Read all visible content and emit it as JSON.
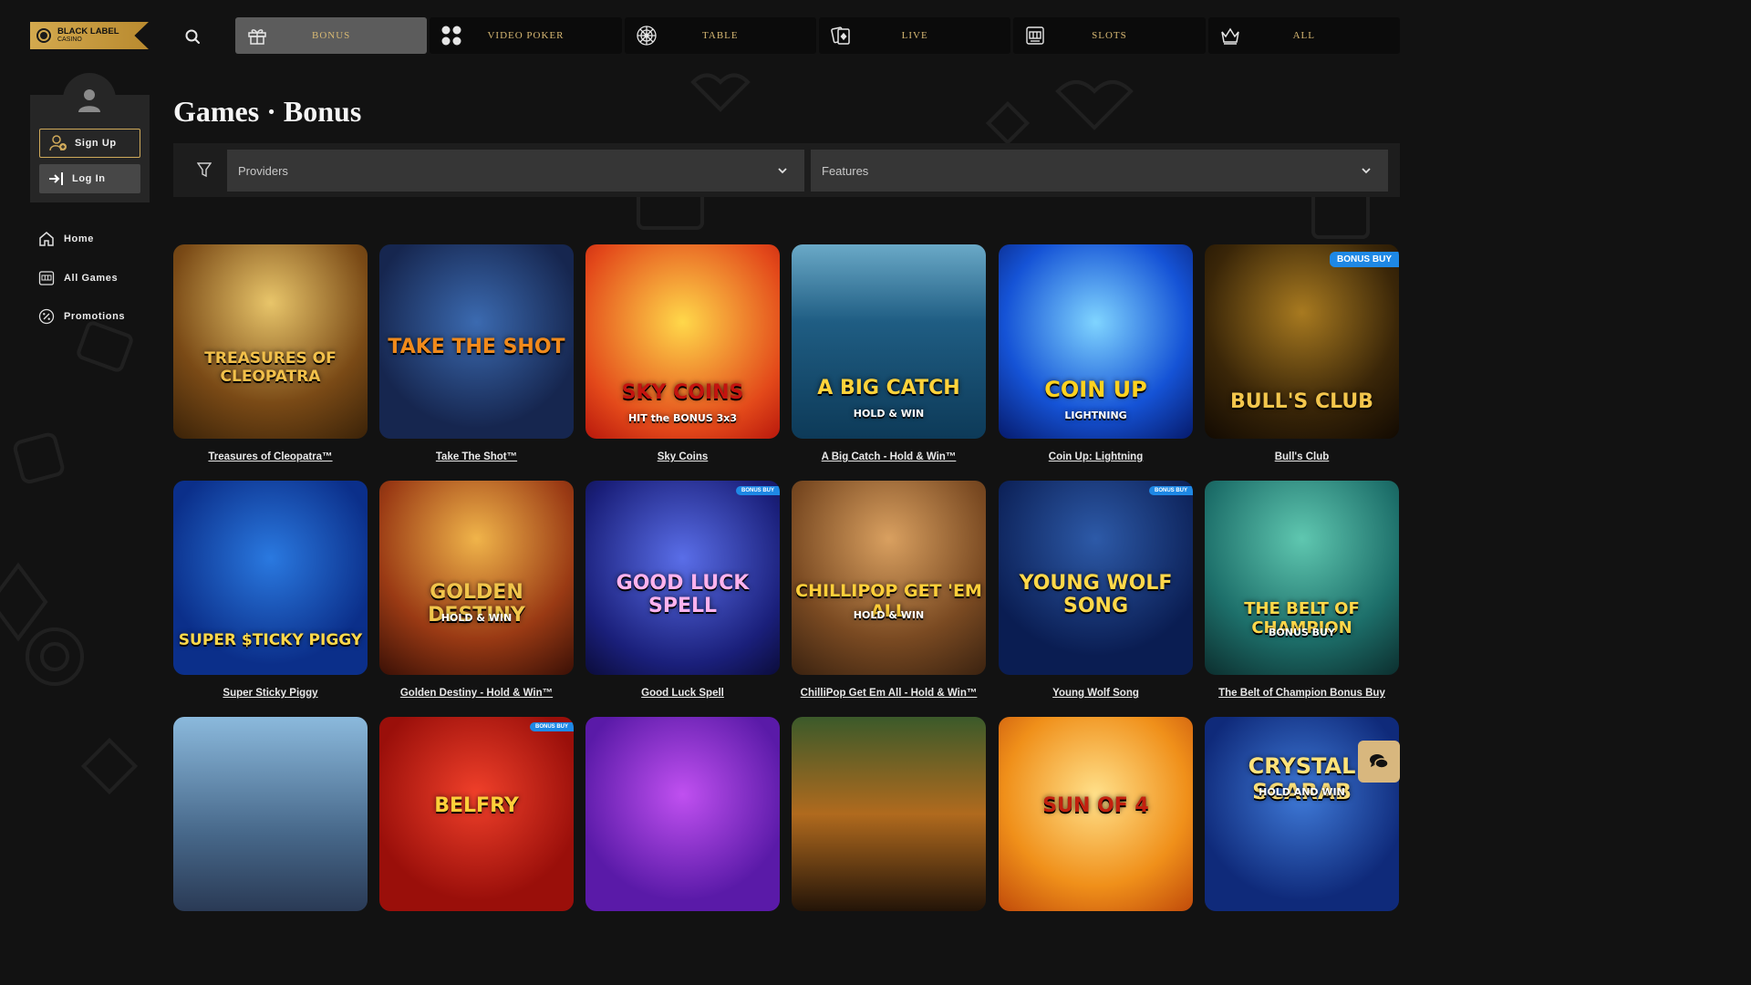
{
  "brand": {
    "line1": "BLACK LABEL",
    "line2": "CASINO",
    "accent": "#d3a94e"
  },
  "nav": {
    "tabs": [
      {
        "label": "BONUS",
        "icon": "gift-icon",
        "active": true
      },
      {
        "label": "VIDEO POKER",
        "icon": "poker-chips-icon",
        "active": false
      },
      {
        "label": "TABLE",
        "icon": "roulette-icon",
        "active": false
      },
      {
        "label": "LIVE",
        "icon": "cards-icon",
        "active": false
      },
      {
        "label": "SLOTS",
        "icon": "slot-machine-icon",
        "active": false
      },
      {
        "label": "ALL",
        "icon": "crown-icon",
        "active": false
      }
    ]
  },
  "sidebar": {
    "signup_label": "Sign Up",
    "login_label": "Log In",
    "items": [
      {
        "label": "Home",
        "icon": "home-icon"
      },
      {
        "label": "All Games",
        "icon": "slot-machine-icon"
      },
      {
        "label": "Promotions",
        "icon": "percent-icon"
      }
    ]
  },
  "page": {
    "title": "Games · Bonus"
  },
  "filters": {
    "providers_placeholder": "Providers",
    "features_placeholder": "Features"
  },
  "games": [
    {
      "name": "Treasures of Cleopatra™",
      "art": "TREASURES OF CLEOPATRA"
    },
    {
      "name": "Take The Shot™",
      "art": "TAKE THE SHOT"
    },
    {
      "name": "Sky Coins",
      "art": "SKY COINS",
      "sub": "HIT the BONUS 3x3"
    },
    {
      "name": "A Big Catch - Hold & Win™",
      "art": "A BIG CATCH",
      "sub": "HOLD & WIN"
    },
    {
      "name": "Coin Up: Lightning",
      "art": "COIN UP",
      "sub": "LIGHTNING"
    },
    {
      "name": "Bull's Club",
      "art": "BULL'S CLUB",
      "badge": "BONUS BUY"
    },
    {
      "name": "Super Sticky Piggy",
      "art": "SUPER $TICKY PIGGY"
    },
    {
      "name": "Golden Destiny - Hold & Win™",
      "art": "GOLDEN DESTINY",
      "sub": "HOLD & WIN"
    },
    {
      "name": "Good Luck Spell",
      "art": "GOOD LUCK SPELL",
      "badge": "BONUS BUY"
    },
    {
      "name": "ChilliPop Get Em All - Hold & Win™",
      "art": "CHILLIPOP GET 'EM ALL",
      "sub": "HOLD & WIN"
    },
    {
      "name": "Young Wolf Song",
      "art": "YOUNG WOLF SONG",
      "badge": "BONUS BUY"
    },
    {
      "name": "The Belt of Champion Bonus Buy",
      "art": "THE BELT OF CHAMPION",
      "sub": "BONUS BUY"
    },
    {
      "name": "",
      "art": ""
    },
    {
      "name": "",
      "art": "BELFRY",
      "badge": "BONUS BUY"
    },
    {
      "name": "",
      "art": ""
    },
    {
      "name": "",
      "art": ""
    },
    {
      "name": "",
      "art": "SUN OF 4"
    },
    {
      "name": "",
      "art": "CRYSTAL SCARAB",
      "sub": "HOLD AND WIN"
    }
  ],
  "colors": {
    "gold": "#d7b873",
    "bg": "#121212",
    "panel": "#262626",
    "badge": "#1e88e5"
  }
}
